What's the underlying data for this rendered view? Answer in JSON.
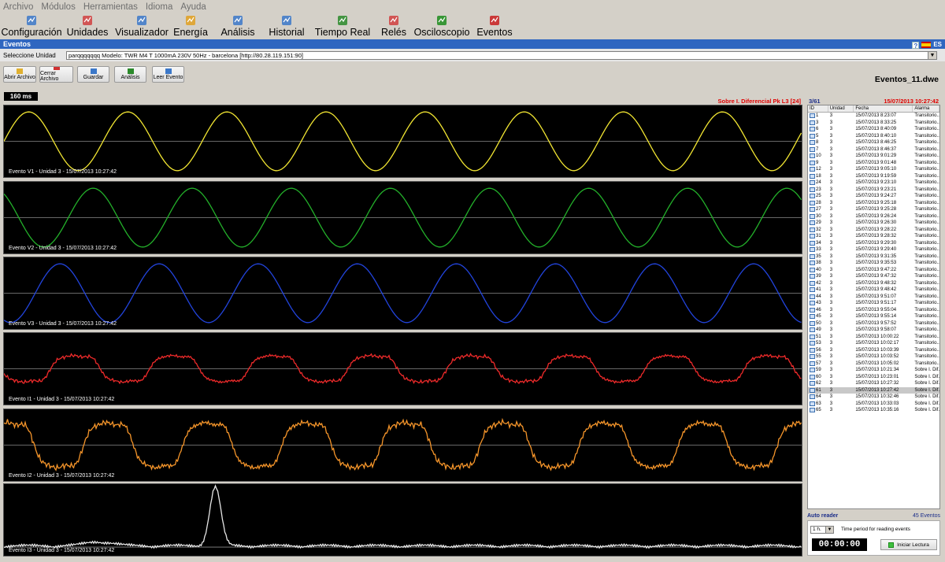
{
  "menu": [
    "Archivo",
    "Módulos",
    "Herramientas",
    "Idioma",
    "Ayuda"
  ],
  "toolbar": [
    {
      "label": "Configuración",
      "icon": "gear-icon",
      "color": "#3b78c9"
    },
    {
      "label": "Unidades",
      "icon": "units-icon",
      "color": "#d04040"
    },
    {
      "label": "Visualizador",
      "icon": "viewer-icon",
      "color": "#3b78c9"
    },
    {
      "label": "Energía",
      "icon": "energy-icon",
      "color": "#e0a020"
    },
    {
      "label": "Análisis",
      "icon": "analysis-icon",
      "color": "#3b78c9"
    },
    {
      "label": "Historial",
      "icon": "history-icon",
      "color": "#3b78c9"
    },
    {
      "label": "Tiempo Real",
      "icon": "realtime-icon",
      "color": "#2a8a2a"
    },
    {
      "label": "Relés",
      "icon": "relay-icon",
      "color": "#d04040"
    },
    {
      "label": "Osciloscopio",
      "icon": "oscilloscope-icon",
      "color": "#1c8c1c"
    },
    {
      "label": "Eventos",
      "icon": "events-icon",
      "color": "#c81e1e"
    }
  ],
  "panel": {
    "title": "Eventos",
    "help": "?",
    "lang": "ES"
  },
  "unit": {
    "label": "Seleccione Unidad",
    "value": "parqqqqqqq  Modelo: TWR M4 T 1000mA 230V 50Hz - barcelona [http://80.28.119.151:90]"
  },
  "actions": [
    {
      "label": "Abrir Archivo",
      "icon": "folder-icon",
      "color": "#e0b030"
    },
    {
      "label": "Cerrar Archivo",
      "icon": "close-file-icon",
      "color": "#d03030"
    },
    {
      "label": "Guardar",
      "icon": "save-icon",
      "color": "#3b78c9"
    },
    {
      "label": "Análisis",
      "icon": "analysis-icon",
      "color": "#2a8a2a"
    },
    {
      "label": "Leer Evento",
      "icon": "read-event-icon",
      "color": "#3b78c9"
    }
  ],
  "file_name": "Eventos_11.dwe",
  "time_window": "160 ms",
  "event_title": "Sobre I. Diferencial Pk L3 [24]",
  "event_counter": "3/61",
  "event_datetime": "15/07/2013 10:27:42",
  "plots": [
    {
      "label": "Evento V1 - Unidad 3 - 15/07/2013 10:27:42",
      "color": "#f2e632",
      "kind": "sine",
      "amp": 0.82,
      "phase": 0.0
    },
    {
      "label": "Evento V2 - Unidad 3 - 15/07/2013 10:27:42",
      "color": "#23b02a",
      "kind": "sine",
      "amp": 0.82,
      "phase": 2.2
    },
    {
      "label": "Evento V3 - Unidad 3 - 15/07/2013 10:27:42",
      "color": "#2244dd",
      "kind": "sine",
      "amp": 0.82,
      "phase": 4.3
    },
    {
      "label": "Evento I1 - Unidad 3 - 15/07/2013 10:27:42",
      "color": "#ee2a2a",
      "kind": "current",
      "amp": 0.5,
      "phase": 3.3
    },
    {
      "label": "Evento I2 - Unidad 3 - 15/07/2013 10:27:42",
      "color": "#f5952a",
      "kind": "current",
      "amp": 0.85,
      "phase": 1.2
    },
    {
      "label": "Evento I3 - Unidad 3 - 15/07/2013 10:27:42",
      "color": "#e6e6e6",
      "kind": "diff",
      "amp": 0.9,
      "phase": 0.0
    }
  ],
  "table": {
    "columns": [
      "ID",
      "Unidad",
      "Fecha",
      "Alarma"
    ],
    "rows": [
      [
        "1",
        "3",
        "15/07/2013 8:23:07",
        "Transitorio..."
      ],
      [
        "3",
        "3",
        "15/07/2013 8:33:25",
        "Transitorio..."
      ],
      [
        "6",
        "3",
        "15/07/2013 8:40:09",
        "Transitorio..."
      ],
      [
        "5",
        "3",
        "15/07/2013 8:40:10",
        "Transitorio..."
      ],
      [
        "8",
        "3",
        "15/07/2013 8:46:25",
        "Transitorio..."
      ],
      [
        "7",
        "3",
        "15/07/2013 8:46:37",
        "Transitorio..."
      ],
      [
        "10",
        "3",
        "15/07/2013 9:01:29",
        "Transitorio..."
      ],
      [
        "9",
        "3",
        "15/07/2013 9:01:48",
        "Transitorio..."
      ],
      [
        "12",
        "3",
        "15/07/2013 9:05:10",
        "Transitorio..."
      ],
      [
        "18",
        "3",
        "15/07/2013 9:19:59",
        "Transitorio..."
      ],
      [
        "24",
        "3",
        "15/07/2013 9:23:10",
        "Transitorio..."
      ],
      [
        "23",
        "3",
        "15/07/2013 9:23:21",
        "Transitorio..."
      ],
      [
        "25",
        "3",
        "15/07/2013 9:24:27",
        "Transitorio..."
      ],
      [
        "28",
        "3",
        "15/07/2013 9:25:18",
        "Transitorio..."
      ],
      [
        "27",
        "3",
        "15/07/2013 9:25:28",
        "Transitorio..."
      ],
      [
        "30",
        "3",
        "15/07/2013 9:26:24",
        "Transitorio..."
      ],
      [
        "29",
        "3",
        "15/07/2013 9:26:30",
        "Transitorio..."
      ],
      [
        "32",
        "3",
        "15/07/2013 9:28:22",
        "Transitorio..."
      ],
      [
        "31",
        "3",
        "15/07/2013 9:28:32",
        "Transitorio..."
      ],
      [
        "34",
        "3",
        "15/07/2013 9:29:30",
        "Transitorio..."
      ],
      [
        "33",
        "3",
        "15/07/2013 9:29:40",
        "Transitorio..."
      ],
      [
        "35",
        "3",
        "15/07/2013 9:31:35",
        "Transitorio..."
      ],
      [
        "38",
        "3",
        "15/07/2013 9:35:53",
        "Transitorio..."
      ],
      [
        "40",
        "3",
        "15/07/2013 9:47:22",
        "Transitorio..."
      ],
      [
        "39",
        "3",
        "15/07/2013 9:47:32",
        "Transitorio..."
      ],
      [
        "42",
        "3",
        "15/07/2013 9:48:32",
        "Transitorio..."
      ],
      [
        "41",
        "3",
        "15/07/2013 9:48:42",
        "Transitorio..."
      ],
      [
        "44",
        "3",
        "15/07/2013 9:51:07",
        "Transitorio..."
      ],
      [
        "43",
        "3",
        "15/07/2013 9:51:17",
        "Transitorio..."
      ],
      [
        "46",
        "3",
        "15/07/2013 9:55:04",
        "Transitorio..."
      ],
      [
        "45",
        "3",
        "15/07/2013 9:55:14",
        "Transitorio..."
      ],
      [
        "50",
        "3",
        "15/07/2013 9:57:52",
        "Transitorio..."
      ],
      [
        "49",
        "3",
        "15/07/2013 9:58:07",
        "Transitorio..."
      ],
      [
        "51",
        "3",
        "15/07/2013 10:00:22",
        "Transitorio..."
      ],
      [
        "53",
        "3",
        "15/07/2013 10:02:17",
        "Transitorio..."
      ],
      [
        "56",
        "3",
        "15/07/2013 10:03:39",
        "Transitorio..."
      ],
      [
        "55",
        "3",
        "15/07/2013 10:03:52",
        "Transitorio..."
      ],
      [
        "57",
        "3",
        "15/07/2013 10:05:02",
        "Transitorio..."
      ],
      [
        "59",
        "3",
        "15/07/2013 10:21:34",
        "Sobre I. Dif..."
      ],
      [
        "60",
        "3",
        "15/07/2013 10:23:01",
        "Sobre I. Dif..."
      ],
      [
        "62",
        "3",
        "15/07/2013 10:27:32",
        "Sobre I. Dif..."
      ],
      [
        "61",
        "3",
        "15/07/2013 10:27:42",
        "Sobre I. Dif..."
      ],
      [
        "64",
        "3",
        "15/07/2013 10:32:46",
        "Sobre I. Dif..."
      ],
      [
        "63",
        "3",
        "15/07/2013 10:33:03",
        "Sobre I. Dif..."
      ],
      [
        "65",
        "3",
        "15/07/2013 10:35:16",
        "Sobre I. Dif..."
      ]
    ],
    "selected_index": 41
  },
  "auto_reader": {
    "title": "Auto reader",
    "events_count": "45 Eventos",
    "period": "1 h.",
    "period_label": "Time period for reading events",
    "clock": "00:00:00",
    "start_label": "Iniciar Lectura"
  }
}
